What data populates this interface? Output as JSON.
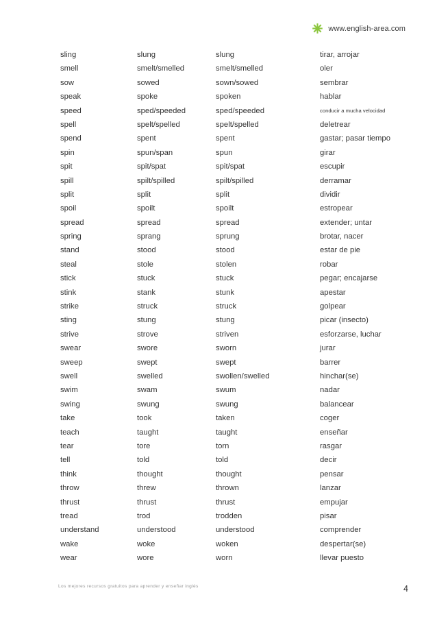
{
  "header": {
    "logo_icon": "asterisk-icon",
    "logo_color": "#8CC63E",
    "site_url": "www.english-area.com"
  },
  "table": {
    "columns": [
      "infinitive",
      "past_simple",
      "past_participle",
      "meaning_es"
    ],
    "rows": [
      {
        "infinitive": "sling",
        "past": "slung",
        "participle": "slung",
        "meaning": "tirar, arrojar",
        "meaning_small": false
      },
      {
        "infinitive": "smell",
        "past": "smelt/smelled",
        "participle": "smelt/smelled",
        "meaning": "oler",
        "meaning_small": false
      },
      {
        "infinitive": "sow",
        "past": "sowed",
        "participle": "sown/sowed",
        "meaning": "sembrar",
        "meaning_small": false
      },
      {
        "infinitive": "speak",
        "past": "spoke",
        "participle": "spoken",
        "meaning": "hablar",
        "meaning_small": false
      },
      {
        "infinitive": "speed",
        "past": "sped/speeded",
        "participle": "sped/speeded",
        "meaning": "conducir a mucha velocidad",
        "meaning_small": true
      },
      {
        "infinitive": "spell",
        "past": "spelt/spelled",
        "participle": "spelt/spelled",
        "meaning": "deletrear",
        "meaning_small": false
      },
      {
        "infinitive": "spend",
        "past": "spent",
        "participle": "spent",
        "meaning": "gastar; pasar tiempo",
        "meaning_small": false
      },
      {
        "infinitive": "spin",
        "past": "spun/span",
        "participle": "spun",
        "meaning": "girar",
        "meaning_small": false
      },
      {
        "infinitive": "spit",
        "past": "spit/spat",
        "participle": "spit/spat",
        "meaning": "escupir",
        "meaning_small": false
      },
      {
        "infinitive": "spill",
        "past": "spilt/spilled",
        "participle": "spilt/spilled",
        "meaning": "derramar",
        "meaning_small": false
      },
      {
        "infinitive": "split",
        "past": "split",
        "participle": "split",
        "meaning": "dividir",
        "meaning_small": false
      },
      {
        "infinitive": "spoil",
        "past": "spoilt",
        "participle": "spoilt",
        "meaning": "estropear",
        "meaning_small": false
      },
      {
        "infinitive": "spread",
        "past": "spread",
        "participle": "spread",
        "meaning": "extender; untar",
        "meaning_small": false
      },
      {
        "infinitive": "spring",
        "past": "sprang",
        "participle": "sprung",
        "meaning": "brotar, nacer",
        "meaning_small": false
      },
      {
        "infinitive": "stand",
        "past": "stood",
        "participle": "stood",
        "meaning": "estar de pie",
        "meaning_small": false
      },
      {
        "infinitive": "steal",
        "past": "stole",
        "participle": "stolen",
        "meaning": "robar",
        "meaning_small": false
      },
      {
        "infinitive": "stick",
        "past": "stuck",
        "participle": "stuck",
        "meaning": "pegar; encajarse",
        "meaning_small": false
      },
      {
        "infinitive": "stink",
        "past": "stank",
        "participle": "stunk",
        "meaning": "apestar",
        "meaning_small": false
      },
      {
        "infinitive": "strike",
        "past": "struck",
        "participle": "struck",
        "meaning": "golpear",
        "meaning_small": false
      },
      {
        "infinitive": "sting",
        "past": "stung",
        "participle": "stung",
        "meaning": "picar (insecto)",
        "meaning_small": false
      },
      {
        "infinitive": "strive",
        "past": "strove",
        "participle": "striven",
        "meaning": "esforzarse, luchar",
        "meaning_small": false
      },
      {
        "infinitive": "swear",
        "past": "swore",
        "participle": "sworn",
        "meaning": "jurar",
        "meaning_small": false
      },
      {
        "infinitive": "sweep",
        "past": "swept",
        "participle": "swept",
        "meaning": "barrer",
        "meaning_small": false
      },
      {
        "infinitive": "swell",
        "past": "swelled",
        "participle": "swollen/swelled",
        "meaning": "hinchar(se)",
        "meaning_small": false
      },
      {
        "infinitive": "swim",
        "past": "swam",
        "participle": "swum",
        "meaning": "nadar",
        "meaning_small": false
      },
      {
        "infinitive": "swing",
        "past": "swung",
        "participle": "swung",
        "meaning": "balancear",
        "meaning_small": false
      },
      {
        "infinitive": "take",
        "past": "took",
        "participle": "taken",
        "meaning": "coger",
        "meaning_small": false
      },
      {
        "infinitive": "teach",
        "past": "taught",
        "participle": "taught",
        "meaning": "enseñar",
        "meaning_small": false
      },
      {
        "infinitive": "tear",
        "past": "tore",
        "participle": "torn",
        "meaning": "rasgar",
        "meaning_small": false
      },
      {
        "infinitive": "tell",
        "past": "told",
        "participle": "told",
        "meaning": "decir",
        "meaning_small": false
      },
      {
        "infinitive": "think",
        "past": "thought",
        "participle": "thought",
        "meaning": "pensar",
        "meaning_small": false
      },
      {
        "infinitive": "throw",
        "past": "threw",
        "participle": "thrown",
        "meaning": "lanzar",
        "meaning_small": false
      },
      {
        "infinitive": "thrust",
        "past": "thrust",
        "participle": "thrust",
        "meaning": "empujar",
        "meaning_small": false
      },
      {
        "infinitive": "tread",
        "past": "trod",
        "participle": "trodden",
        "meaning": "pisar",
        "meaning_small": false
      },
      {
        "infinitive": "understand",
        "past": "understood",
        "participle": "understood",
        "meaning": "comprender",
        "meaning_small": false
      },
      {
        "infinitive": "wake",
        "past": "woke",
        "participle": "woken",
        "meaning": "despertar(se)",
        "meaning_small": false
      },
      {
        "infinitive": "wear",
        "past": "wore",
        "participle": "worn",
        "meaning": "llevar puesto",
        "meaning_small": false
      }
    ]
  },
  "footer": {
    "note": "Los mejores recursos gratuitos para aprender y enseñar inglés",
    "page_number": "4"
  }
}
